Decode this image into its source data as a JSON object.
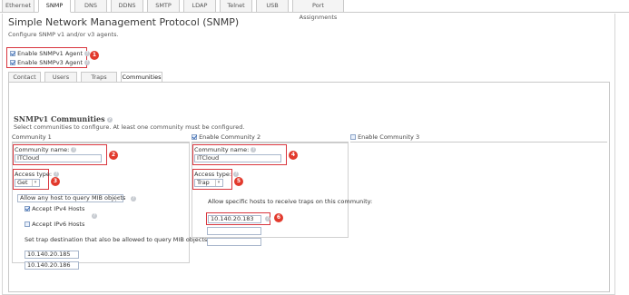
{
  "top_tabs": [
    "Ethernet",
    "SNMP",
    "DNS",
    "DDNS",
    "SMTP",
    "LDAP",
    "Telnet",
    "USB",
    "Port Assignments"
  ],
  "active_top_tab": "SNMP",
  "header": {
    "title": "Simple Network Management Protocol (SNMP)",
    "subtitle": "Configure SNMP v1 and/or v3 agents."
  },
  "agents": {
    "v1_label": "Enable SNMPv1 Agent",
    "v1_checked": true,
    "v3_label": "Enable SNMPv3 Agent",
    "v3_checked": true
  },
  "sub_tabs": [
    "Contact",
    "Users",
    "Traps",
    "Communities"
  ],
  "active_sub_tab": "Communities",
  "communities": {
    "title": "SNMPv1 Communities",
    "subtitle": "Select communities to configure. At least one community must be configured.",
    "col1_header": "Community 1",
    "col2_header": "Enable Community 2",
    "col3_header": "Enable Community 3",
    "community_name_label": "Community name:",
    "access_type_label": "Access type:",
    "c1": {
      "name": "ITCloud",
      "access": "Get",
      "query_mode": "Allow any host to query MIB objects",
      "accept_ipv4_label": "Accept IPv4 Hosts",
      "accept_ipv6_label": "Accept IPv6 Hosts",
      "trap_dest_label": "Set trap destination that also be allowed to query MIB objects:",
      "trap_hosts": [
        "10.140.20.185",
        "10.140.20.186"
      ]
    },
    "c2": {
      "name": "ITCloud",
      "access": "Trap",
      "allow_hosts_label": "Allow specific hosts to receive traps on this community:",
      "hosts": [
        "10.140.20.183",
        "",
        ""
      ]
    }
  },
  "badges": [
    "1",
    "2",
    "3",
    "4",
    "5",
    "6"
  ],
  "colors": {
    "callout_red": "#e23a2d",
    "border_red": "#d9363e"
  }
}
